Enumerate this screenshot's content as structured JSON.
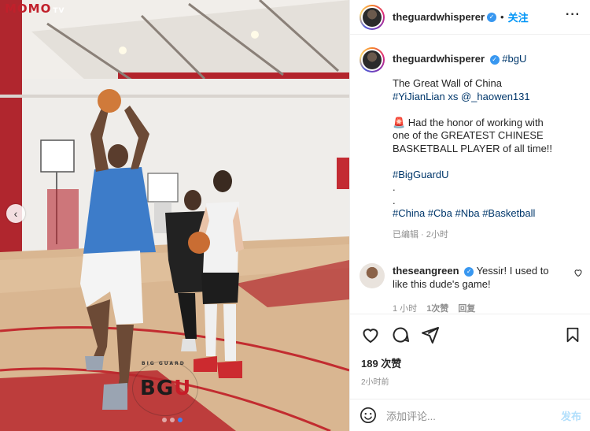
{
  "media": {
    "watermark": "MOMO",
    "watermark_tv": "TV",
    "logo_text_main": "BG",
    "logo_text_accent": "U",
    "logo_arc_text": "BIG GUARD",
    "carousel_dots": 3,
    "active_dot": 2
  },
  "post": {
    "username": "theguardwhisperer",
    "follow_label": "关注",
    "caption_tag": "#bgU",
    "caption_lines": [
      "The Great Wall of China",
      "#YiJianLian xs @_haowen131",
      "",
      "🚨 Had the honor of working with",
      "one of the GREATEST CHINESE",
      "BASKETBALL PLAYER of all time!!",
      "",
      "#BigGuardU",
      ".",
      ".",
      "#China #Cba #Nba #Basketball"
    ],
    "caption_meta": "已编辑 · 2小时"
  },
  "comment": {
    "username": "theseangreen",
    "text": "Yessir! I used to like this dude's game!",
    "time": "1 小时",
    "likes": "1次赞",
    "reply": "回复"
  },
  "actions": {
    "likes": "189 次赞",
    "time_ago": "2小时前"
  },
  "add_comment": {
    "placeholder": "添加评论...",
    "post_label": "发布"
  },
  "colors": {
    "link": "#00376b",
    "follow": "#0095f6",
    "verified": "#3897f0",
    "muted": "#8e8e8e"
  }
}
